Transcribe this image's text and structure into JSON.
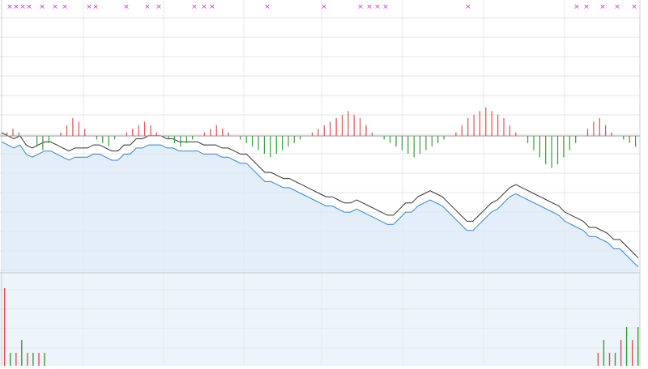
{
  "chart_data": [
    {
      "type": "line",
      "panel": "price",
      "series": [
        {
          "values": [
            93,
            92,
            91,
            92,
            89,
            88,
            89,
            90,
            90,
            89,
            88,
            87,
            88,
            88,
            88,
            89,
            89,
            88,
            87,
            87,
            89,
            89,
            91,
            91,
            92,
            92,
            92,
            91,
            91,
            90,
            90,
            90,
            90,
            89,
            89,
            89,
            88,
            88,
            87,
            86,
            86,
            84,
            82,
            80,
            80,
            79,
            78,
            78,
            77,
            76,
            75,
            74,
            73,
            72,
            72,
            71,
            70,
            70,
            71,
            70,
            69,
            68,
            67,
            66,
            66,
            68,
            70,
            70,
            72,
            73,
            74,
            73,
            72,
            70,
            68,
            66,
            64,
            64,
            66,
            68,
            70,
            71,
            73,
            75,
            76,
            75,
            74,
            73,
            72,
            71,
            70,
            69,
            67,
            66,
            65,
            64,
            62,
            62,
            61,
            60,
            58,
            58,
            56,
            54,
            52
          ]
        },
        {
          "values": [
            90,
            89,
            88,
            89,
            86,
            85,
            86,
            87,
            87,
            86,
            85,
            84,
            85,
            85,
            85,
            86,
            86,
            85,
            84,
            84,
            86,
            86,
            88,
            88,
            89,
            89,
            89,
            88,
            88,
            87,
            87,
            87,
            87,
            86,
            86,
            86,
            85,
            85,
            84,
            83,
            83,
            81,
            79,
            77,
            77,
            76,
            75,
            75,
            74,
            73,
            72,
            71,
            70,
            69,
            69,
            68,
            67,
            67,
            68,
            67,
            66,
            65,
            64,
            63,
            63,
            65,
            67,
            67,
            69,
            70,
            71,
            70,
            69,
            67,
            65,
            63,
            61,
            61,
            63,
            65,
            67,
            68,
            70,
            72,
            73,
            72,
            71,
            70,
            69,
            68,
            67,
            66,
            64,
            63,
            62,
            61,
            59,
            59,
            58,
            57,
            55,
            55,
            53,
            51,
            49
          ]
        }
      ]
    },
    {
      "type": "bar",
      "panel": "oscillator",
      "values": [
        1,
        2,
        1,
        0,
        0,
        -3,
        -4,
        -2,
        0,
        1,
        3,
        5,
        4,
        2,
        0,
        -1,
        -2,
        -3,
        -1,
        0,
        1,
        2,
        3,
        4,
        3,
        1,
        0,
        -1,
        -2,
        -3,
        -2,
        -1,
        0,
        1,
        2,
        3,
        2,
        1,
        0,
        -1,
        -2,
        -3,
        -4,
        -5,
        -6,
        -5,
        -4,
        -3,
        -2,
        -1,
        0,
        1,
        2,
        3,
        4,
        5,
        6,
        7,
        6,
        5,
        3,
        1,
        0,
        -1,
        -2,
        -3,
        -4,
        -5,
        -6,
        -5,
        -4,
        -3,
        -2,
        -1,
        0,
        1,
        3,
        5,
        6,
        7,
        8,
        7,
        6,
        5,
        3,
        1,
        0,
        -2,
        -4,
        -6,
        -8,
        -9,
        -8,
        -6,
        -4,
        -2,
        0,
        2,
        4,
        5,
        3,
        1,
        0,
        -1,
        -2,
        -3
      ]
    },
    {
      "type": "bar",
      "panel": "volume",
      "values": [
        6,
        1,
        1,
        2,
        1,
        1,
        1,
        1,
        0,
        0,
        0,
        0,
        0,
        0,
        0,
        0,
        0,
        0,
        0,
        0,
        0,
        0,
        0,
        0,
        0,
        0,
        0,
        0,
        0,
        0,
        0,
        0,
        0,
        0,
        0,
        0,
        0,
        0,
        0,
        0,
        0,
        0,
        0,
        0,
        0,
        0,
        0,
        0,
        0,
        0,
        0,
        0,
        0,
        0,
        0,
        0,
        0,
        0,
        0,
        0,
        0,
        0,
        0,
        0,
        0,
        0,
        0,
        0,
        0,
        0,
        0,
        0,
        0,
        0,
        0,
        0,
        0,
        0,
        0,
        0,
        0,
        0,
        0,
        0,
        0,
        0,
        0,
        0,
        0,
        0,
        0,
        0,
        0,
        0,
        0,
        0,
        0,
        0,
        0,
        0,
        0,
        0,
        0,
        0,
        1,
        2,
        1,
        1,
        2,
        3,
        2,
        3
      ]
    }
  ]
}
